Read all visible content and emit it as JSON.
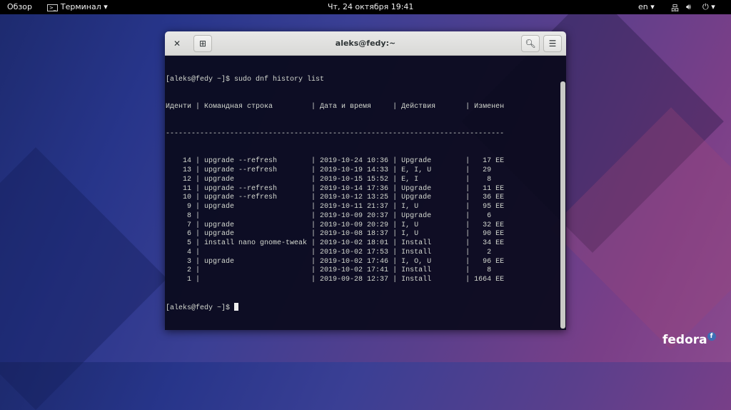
{
  "topbar": {
    "activities": "Обзор",
    "app_menu": "Терминал",
    "clock": "Чт, 24 октября  19:41",
    "lang": "en"
  },
  "window": {
    "title": "aleks@fedy:~"
  },
  "terminal": {
    "prompt": "[aleks@fedy ~]$ ",
    "command": "sudo dnf history list",
    "headers": {
      "id": "Иденти",
      "cmd": "Командная строка",
      "date": "Дата и время",
      "action": "Действия",
      "altered": "Изменен"
    },
    "separator": "-------------------------------------------------------------------------------",
    "rows": [
      {
        "id": "14",
        "cmd": "upgrade --refresh",
        "date": "2019-10-24 10:36",
        "action": "Upgrade",
        "altered": "17",
        "flag": "EE"
      },
      {
        "id": "13",
        "cmd": "upgrade --refresh",
        "date": "2019-10-19 14:33",
        "action": "E, I, U",
        "altered": "29",
        "flag": ""
      },
      {
        "id": "12",
        "cmd": "upgrade",
        "date": "2019-10-15 15:52",
        "action": "E, I",
        "altered": "8",
        "flag": ""
      },
      {
        "id": "11",
        "cmd": "upgrade --refresh",
        "date": "2019-10-14 17:36",
        "action": "Upgrade",
        "altered": "11",
        "flag": "EE"
      },
      {
        "id": "10",
        "cmd": "upgrade --refresh",
        "date": "2019-10-12 13:25",
        "action": "Upgrade",
        "altered": "36",
        "flag": "EE"
      },
      {
        "id": "9",
        "cmd": "upgrade",
        "date": "2019-10-11 21:37",
        "action": "I, U",
        "altered": "95",
        "flag": "EE"
      },
      {
        "id": "8",
        "cmd": "",
        "date": "2019-10-09 20:37",
        "action": "Upgrade",
        "altered": "6",
        "flag": ""
      },
      {
        "id": "7",
        "cmd": "upgrade",
        "date": "2019-10-09 20:29",
        "action": "I, U",
        "altered": "32",
        "flag": "EE"
      },
      {
        "id": "6",
        "cmd": "upgrade",
        "date": "2019-10-08 18:37",
        "action": "I, U",
        "altered": "90",
        "flag": "EE"
      },
      {
        "id": "5",
        "cmd": "install nano gnome-tweak",
        "date": "2019-10-02 18:01",
        "action": "Install",
        "altered": "34",
        "flag": "EE"
      },
      {
        "id": "4",
        "cmd": "",
        "date": "2019-10-02 17:53",
        "action": "Install",
        "altered": "2",
        "flag": ""
      },
      {
        "id": "3",
        "cmd": "upgrade",
        "date": "2019-10-02 17:46",
        "action": "I, O, U",
        "altered": "96",
        "flag": "EE"
      },
      {
        "id": "2",
        "cmd": "",
        "date": "2019-10-02 17:41",
        "action": "Install",
        "altered": "8",
        "flag": ""
      },
      {
        "id": "1",
        "cmd": "",
        "date": "2019-09-28 12:37",
        "action": "Install",
        "altered": "1664",
        "flag": "EE"
      }
    ]
  },
  "logo": {
    "text": "fedora"
  }
}
